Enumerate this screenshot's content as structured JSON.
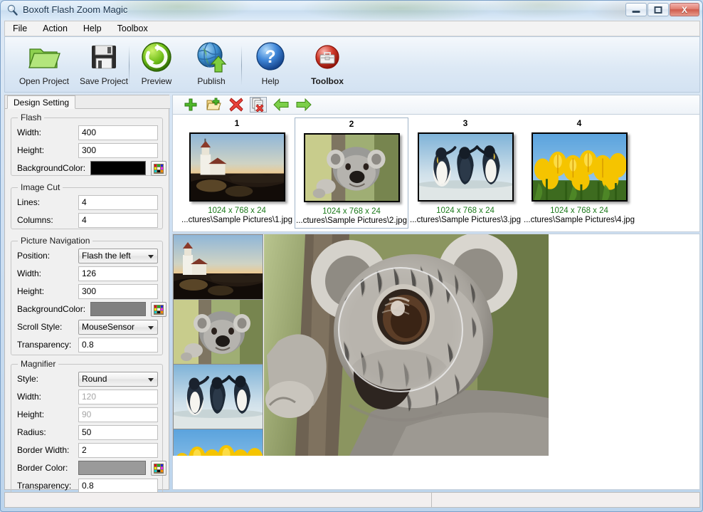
{
  "window": {
    "title": "Boxoft Flash Zoom Magic",
    "icon": "magnifier-icon",
    "buttons": {
      "minimize": "minimize",
      "maximize": "maximize",
      "close": "X"
    }
  },
  "menubar": {
    "items": [
      {
        "label": "File",
        "name": "menu-file"
      },
      {
        "label": "Action",
        "name": "menu-action"
      },
      {
        "label": "Help",
        "name": "menu-help"
      },
      {
        "label": "Toolbox",
        "name": "menu-toolbox"
      }
    ]
  },
  "toolbar": {
    "buttons": [
      {
        "label": "Open Project",
        "icon": "open-folder-icon"
      },
      {
        "label": "Save Project",
        "icon": "floppy-disk-icon"
      },
      {
        "label": "Preview",
        "icon": "refresh-circle-icon"
      },
      {
        "label": "Publish",
        "icon": "globe-upload-icon"
      },
      {
        "label": "Help",
        "icon": "question-mark-icon"
      },
      {
        "label": "Toolbox",
        "icon": "toolbox-icon"
      }
    ]
  },
  "left_panel": {
    "tab": "Design Setting",
    "groups": [
      {
        "title": "Flash",
        "fields": [
          {
            "label": "Width:",
            "value": "400",
            "type": "text"
          },
          {
            "label": "Height:",
            "value": "300",
            "type": "text"
          },
          {
            "label": "BackgroundColor:",
            "value": "#000000",
            "type": "color"
          }
        ]
      },
      {
        "title": "Image Cut",
        "fields": [
          {
            "label": "Lines:",
            "value": "4",
            "type": "text"
          },
          {
            "label": "Columns:",
            "value": "4",
            "type": "text"
          }
        ]
      },
      {
        "title": "Picture Navigation",
        "fields": [
          {
            "label": "Position:",
            "value": "Flash the left",
            "type": "select"
          },
          {
            "label": "Width:",
            "value": "126",
            "type": "text"
          },
          {
            "label": "Height:",
            "value": "300",
            "type": "text"
          },
          {
            "label": "BackgroundColor:",
            "value": "#808080",
            "type": "color"
          },
          {
            "label": "Scroll Style:",
            "value": "MouseSensor",
            "type": "select"
          },
          {
            "label": "Transparency:",
            "value": "0.8",
            "type": "text"
          }
        ]
      },
      {
        "title": "Magnifier",
        "fields": [
          {
            "label": "Style:",
            "value": "Round",
            "type": "select"
          },
          {
            "label": "Width:",
            "value": "120",
            "type": "text",
            "disabled": true
          },
          {
            "label": "Height:",
            "value": "90",
            "type": "text",
            "disabled": true
          },
          {
            "label": "Radius:",
            "value": "50",
            "type": "text"
          },
          {
            "label": "Border Width:",
            "value": "2",
            "type": "text"
          },
          {
            "label": "Border Color:",
            "value": "#9a9a9a",
            "type": "color"
          },
          {
            "label": "Transparency:",
            "value": "0.8",
            "type": "text"
          }
        ]
      }
    ]
  },
  "thumb_toolbar": {
    "buttons": [
      {
        "name": "add-image-button",
        "icon": "green-plus-icon",
        "selected": false
      },
      {
        "name": "add-folder-button",
        "icon": "folder-plus-icon",
        "selected": false
      },
      {
        "name": "delete-image-button",
        "icon": "red-x-icon",
        "selected": false
      },
      {
        "name": "delete-all-button",
        "icon": "pages-delete-icon",
        "selected": true
      },
      {
        "name": "move-left-button",
        "icon": "green-arrow-left-icon",
        "selected": false
      },
      {
        "name": "move-right-button",
        "icon": "green-arrow-right-icon",
        "selected": false
      }
    ]
  },
  "thumbnails": {
    "items": [
      {
        "number": "1",
        "resolution": "1024 x 768 x 24",
        "path": "...ctures\\Sample Pictures\\1.jpg",
        "image": "lighthouse",
        "selected": false
      },
      {
        "number": "2",
        "resolution": "1024 x 768 x 24",
        "path": "...ctures\\Sample Pictures\\2.jpg",
        "image": "koala",
        "selected": true
      },
      {
        "number": "3",
        "resolution": "1024 x 768 x 24",
        "path": "...ctures\\Sample Pictures\\3.jpg",
        "image": "penguins",
        "selected": false
      },
      {
        "number": "4",
        "resolution": "1024 x 768 x 24",
        "path": "...ctures\\Sample Pictures\\4.jpg",
        "image": "tulips",
        "selected": false
      }
    ]
  },
  "preview": {
    "nav_images": [
      "lighthouse",
      "koala",
      "penguins",
      "tulips"
    ],
    "main_image": "koala",
    "magnifier_shape": "round"
  },
  "statusbar": {
    "left": "",
    "right": ""
  },
  "colors": {
    "flash_background": "#000000",
    "nav_background": "#808080",
    "magnifier_border": "#9a9a9a",
    "resolution_text": "#1d7a1d"
  }
}
